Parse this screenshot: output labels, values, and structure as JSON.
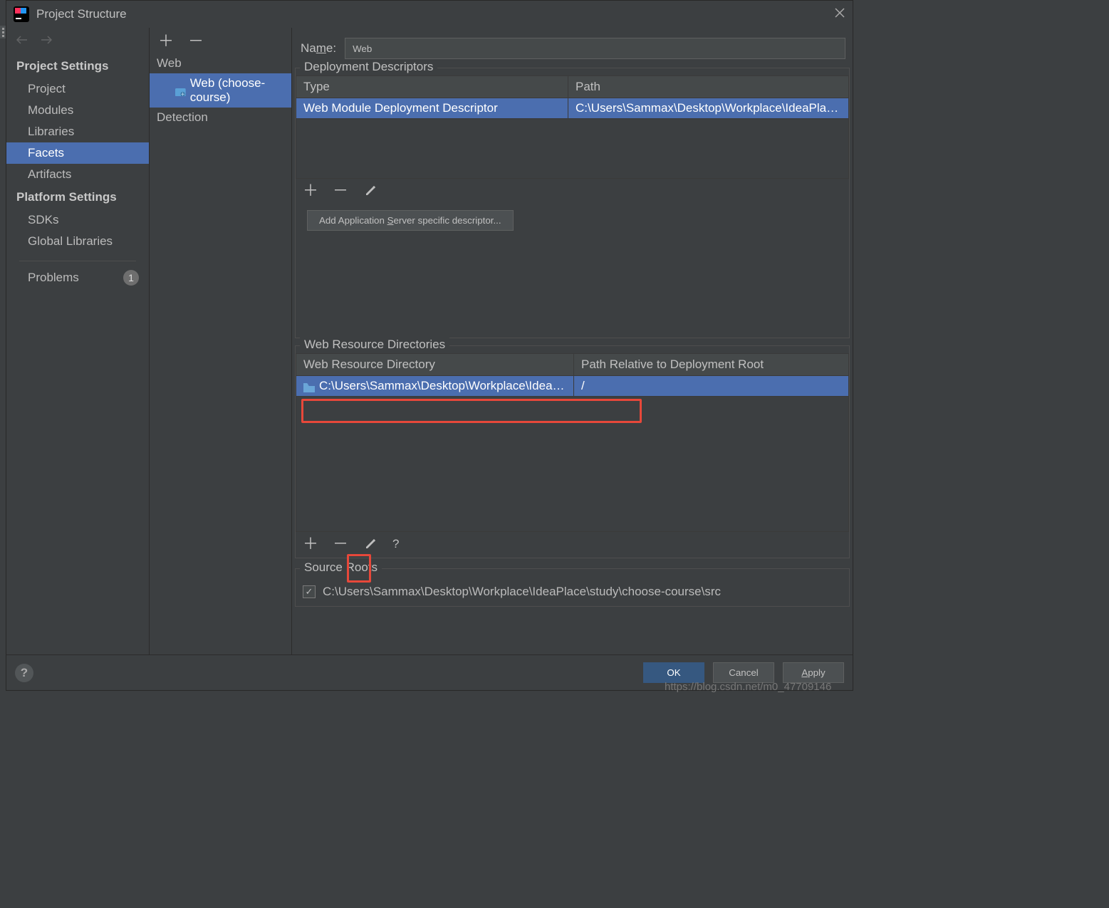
{
  "window": {
    "title": "Project Structure"
  },
  "sidebar": {
    "groups": {
      "project_settings": "Project Settings",
      "platform_settings": "Platform Settings"
    },
    "items": {
      "project": "Project",
      "modules": "Modules",
      "libraries": "Libraries",
      "facets": "Facets",
      "artifacts": "Artifacts",
      "sdks": "SDKs",
      "global_libraries": "Global Libraries",
      "problems": "Problems"
    },
    "problems_count": "1"
  },
  "facet_tree": {
    "web": "Web",
    "web_module": "Web (choose-course)",
    "detection": "Detection"
  },
  "form": {
    "name_label": "Name:",
    "name_value": "Web"
  },
  "deployment": {
    "section_title": "Deployment Descriptors",
    "columns": {
      "type": "Type",
      "path": "Path"
    },
    "row": {
      "type": "Web Module Deployment Descriptor",
      "path": "C:\\Users\\Sammax\\Desktop\\Workplace\\IdeaPlace\\study\\ch"
    },
    "add_server_btn": "Add Application Server specific descriptor..."
  },
  "webres": {
    "section_title": "Web Resource Directories",
    "columns": {
      "dir": "Web Resource Directory",
      "rel": "Path Relative to Deployment Root"
    },
    "row": {
      "dir": "C:\\Users\\Sammax\\Desktop\\Workplace\\IdeaPlace\\st...",
      "rel": "/"
    },
    "help_q": "?"
  },
  "source_roots": {
    "section_title": "Source Roots",
    "item": "C:\\Users\\Sammax\\Desktop\\Workplace\\IdeaPlace\\study\\choose-course\\src",
    "checked": "✓"
  },
  "footer": {
    "ok": "OK",
    "cancel": "Cancel",
    "apply": "Apply"
  },
  "watermark": "https://blog.csdn.net/m0_47709146"
}
